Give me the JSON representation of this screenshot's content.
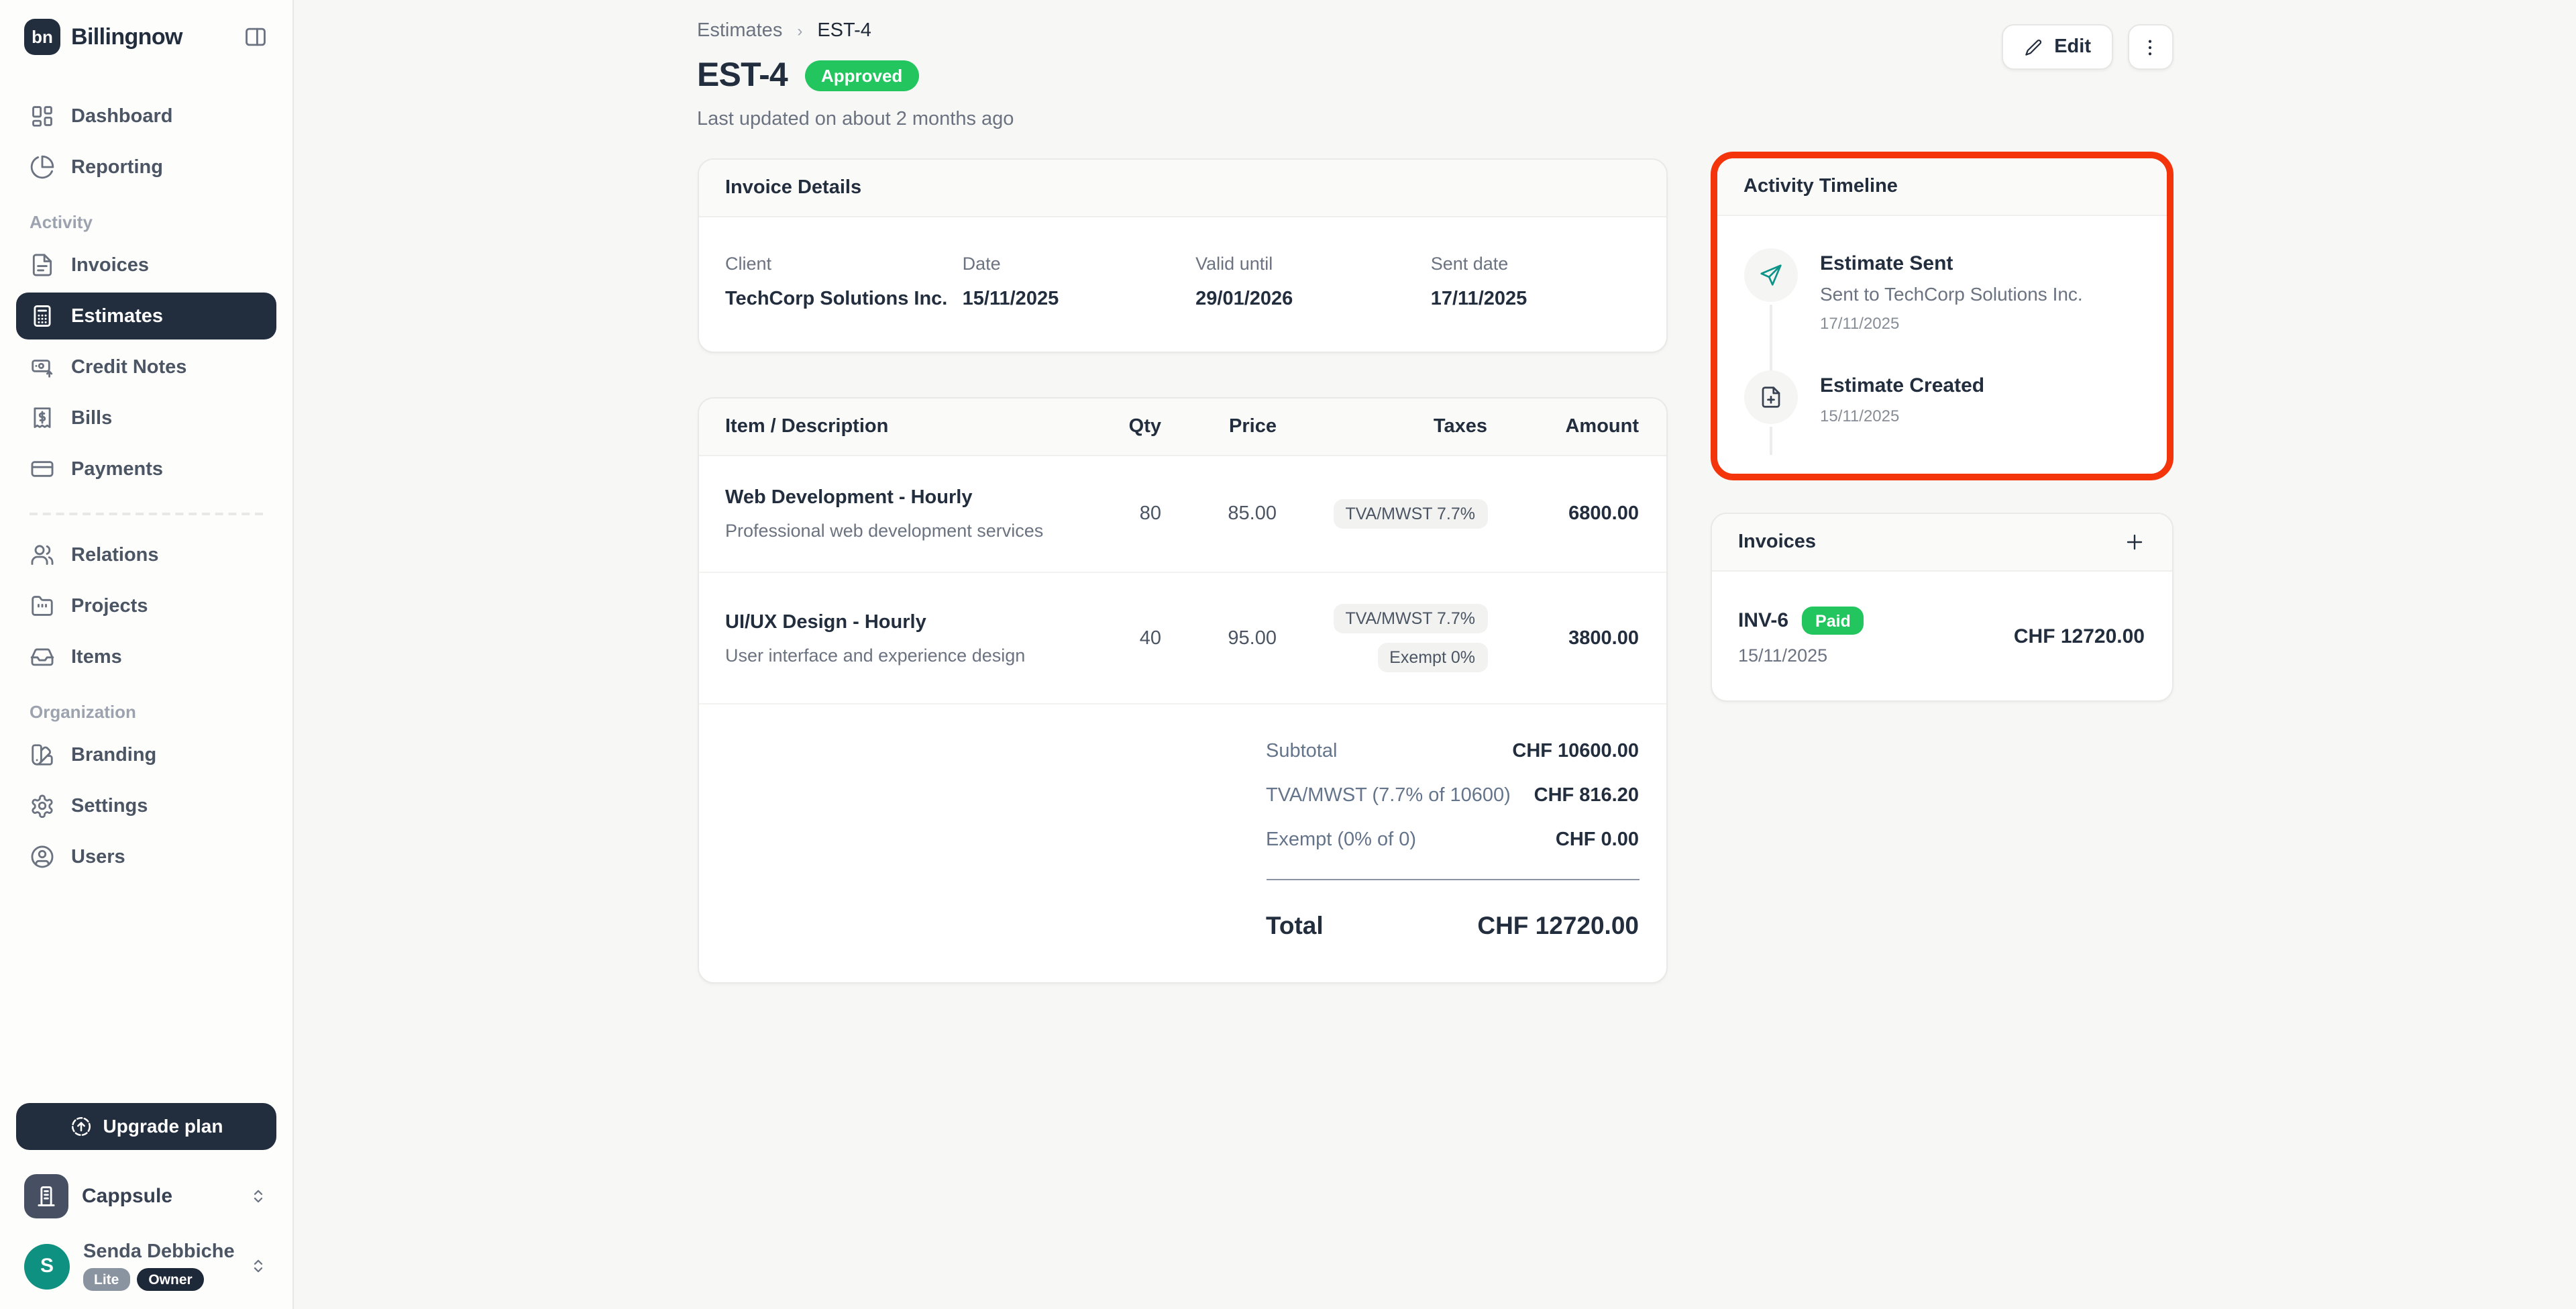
{
  "app": {
    "name": "Billingnow",
    "logo_monogram": "bn"
  },
  "sidebar": {
    "nav_top": [
      {
        "label": "Dashboard"
      },
      {
        "label": "Reporting"
      }
    ],
    "section_activity": "Activity",
    "nav_activity": [
      {
        "label": "Invoices"
      },
      {
        "label": "Estimates",
        "active": true
      },
      {
        "label": "Credit Notes"
      },
      {
        "label": "Bills"
      },
      {
        "label": "Payments"
      }
    ],
    "nav_middle": [
      {
        "label": "Relations"
      },
      {
        "label": "Projects"
      },
      {
        "label": "Items"
      }
    ],
    "section_organization": "Organization",
    "nav_org": [
      {
        "label": "Branding"
      },
      {
        "label": "Settings"
      },
      {
        "label": "Users"
      }
    ],
    "upgrade_label": "Upgrade plan",
    "workspace_name": "Cappsule",
    "user": {
      "name": "Senda Debbiche",
      "initial": "S",
      "plan_badge": "Lite",
      "role_badge": "Owner"
    }
  },
  "header": {
    "breadcrumb_parent": "Estimates",
    "breadcrumb_sep": "›",
    "breadcrumb_current": "EST-4",
    "title": "EST-4",
    "status": "Approved",
    "subtitle": "Last updated on about 2 months ago",
    "edit_label": "Edit"
  },
  "invoice_details": {
    "title": "Invoice Details",
    "fields": [
      {
        "label": "Client",
        "value": "TechCorp Solutions Inc."
      },
      {
        "label": "Date",
        "value": "15/11/2025"
      },
      {
        "label": "Valid until",
        "value": "29/01/2026"
      },
      {
        "label": "Sent date",
        "value": "17/11/2025"
      }
    ]
  },
  "items_table": {
    "headers": [
      "Item / Description",
      "Qty",
      "Price",
      "Taxes",
      "Amount"
    ],
    "rows": [
      {
        "name": "Web Development - Hourly",
        "description": "Professional web development services",
        "qty": "80",
        "price": "85.00",
        "taxes": [
          "TVA/MWST 7.7%"
        ],
        "amount": "6800.00"
      },
      {
        "name": "UI/UX Design - Hourly",
        "description": "User interface and experience design",
        "qty": "40",
        "price": "95.00",
        "taxes": [
          "TVA/MWST 7.7%",
          "Exempt 0%"
        ],
        "amount": "3800.00"
      }
    ],
    "totals": [
      {
        "label": "Subtotal",
        "value": "CHF 10600.00"
      },
      {
        "label": "TVA/MWST (7.7% of 10600)",
        "value": "CHF 816.20"
      },
      {
        "label": "Exempt (0% of 0)",
        "value": "CHF 0.00"
      }
    ],
    "total_label": "Total",
    "total_value": "CHF 12720.00"
  },
  "activity_timeline": {
    "title": "Activity Timeline",
    "events": [
      {
        "title": "Estimate Sent",
        "description": "Sent to TechCorp Solutions Inc.",
        "date": "17/11/2025"
      },
      {
        "title": "Estimate Created",
        "date": "15/11/2025"
      }
    ]
  },
  "invoices_panel": {
    "title": "Invoices",
    "rows": [
      {
        "number": "INV-6",
        "status": "Paid",
        "date": "15/11/2025",
        "amount": "CHF 12720.00"
      }
    ]
  },
  "annotation": {
    "highlighted_panel": "Activity Timeline",
    "color": "#f4350c"
  },
  "colors": {
    "accent_green": "#22c55e",
    "dark_navy": "#222d3d",
    "teal": "#0d9488",
    "annotation_red": "#f4350c"
  }
}
